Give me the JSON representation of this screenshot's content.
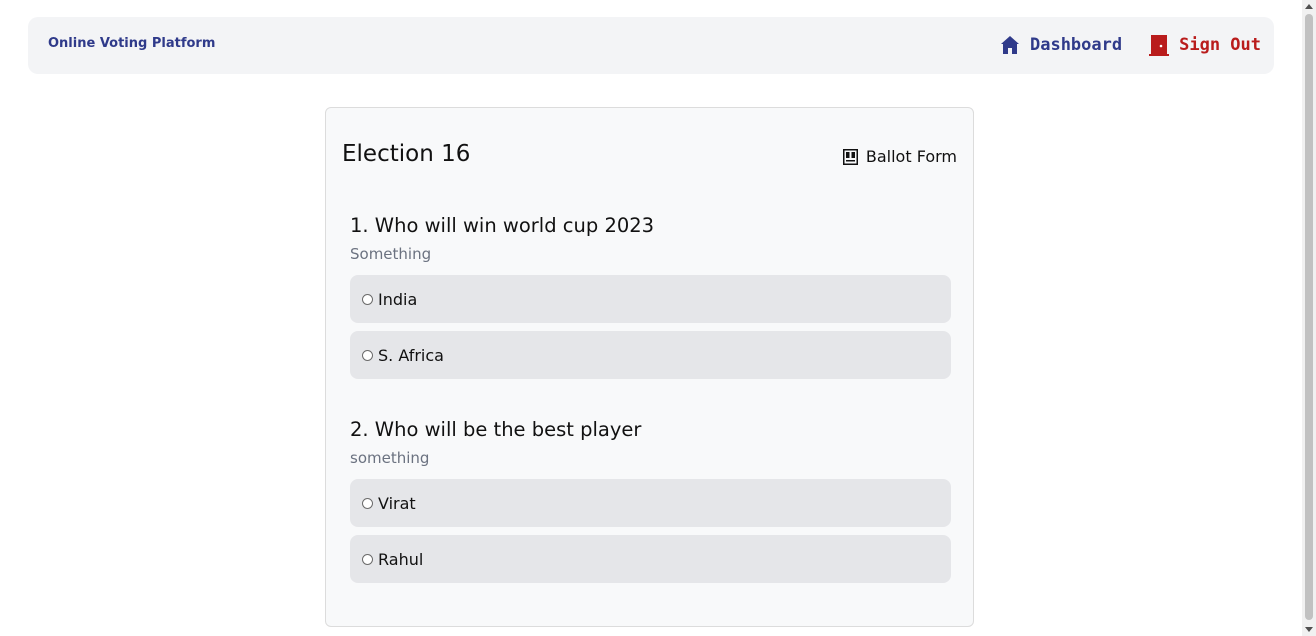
{
  "navbar": {
    "brand": "Online Voting Platform",
    "dashboard_label": "Dashboard",
    "signout_label": "Sign Out",
    "dashboard_icon": "home-icon",
    "signout_icon": "door-icon",
    "dashboard_color": "#2f3a8a",
    "signout_color": "#b91c1c"
  },
  "election": {
    "title": "Election 16",
    "ballot_label": "Ballot Form",
    "ballot_icon": "ballot-icon"
  },
  "questions": [
    {
      "title": "1. Who will win world cup 2023",
      "description": "Something",
      "options": [
        {
          "label": "India",
          "selected": false
        },
        {
          "label": "S. Africa",
          "selected": false
        }
      ]
    },
    {
      "title": "2. Who will be the best player",
      "description": "something",
      "options": [
        {
          "label": "Virat",
          "selected": false
        },
        {
          "label": "Rahul",
          "selected": false
        }
      ]
    }
  ]
}
